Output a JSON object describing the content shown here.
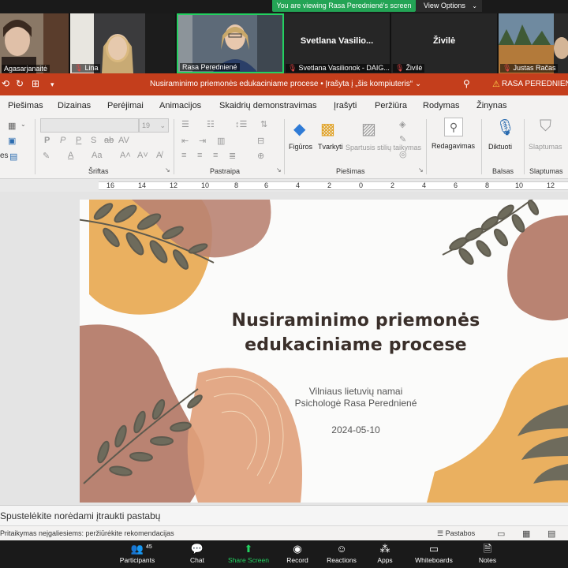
{
  "zoom": {
    "share_banner": "You are viewing Rasa Peredniené's screen",
    "view_options": "View Options",
    "participants": [
      {
        "name": "Agasarjanaitė",
        "has_video": true
      },
      {
        "name": "Lina",
        "has_video": true
      },
      {
        "name": "Rasa Peredniené",
        "has_video": true,
        "active": true
      },
      {
        "name": "Svetlana Vasilionok - DAIG...",
        "display": "Svetlana  Vasilio...",
        "muted": true
      },
      {
        "name": "Živilė",
        "display": "Živilė",
        "muted": true
      },
      {
        "name": "Justas Račas",
        "has_video": true,
        "muted": true
      }
    ],
    "toolbar": {
      "participants": "Participants",
      "participants_count": "45",
      "chat": "Chat",
      "share_screen": "Share Screen",
      "record": "Record",
      "reactions": "Reactions",
      "apps": "Apps",
      "whiteboards": "Whiteboards",
      "notes": "Notes"
    }
  },
  "ppt": {
    "doc_title": "Nusiraminimo priemonės edukaciniame procese  •  Įrašyta į „šis kompiuteris“ ⌄",
    "user": "RASA PEREDNIENĖ",
    "tabs": [
      "Piešimas",
      "Dizainas",
      "Perėjimai",
      "Animacijos",
      "Skaidrių demonstravimas",
      "Įrašyti",
      "Peržiūra",
      "Rodymas",
      "Žinynas"
    ],
    "font_size": "19",
    "groups": {
      "font": "Šriftas",
      "paragraph": "Pastraipa",
      "drawing": "Piešimas",
      "voice": "Balsas",
      "sensitivity": "Slaptumas"
    },
    "side_label": "es",
    "buttons": {
      "shapes": "Figūros",
      "arrange": "Tvarkyti",
      "quick_styles": "Spartusis stilių taikymas",
      "editing": "Redagavimas",
      "dictate": "Diktuoti",
      "sensitivity": "Slaptumas"
    },
    "ruler_numbers": [
      "16",
      "14",
      "12",
      "10",
      "8",
      "6",
      "4",
      "2",
      "0",
      "2",
      "4",
      "6",
      "8",
      "10",
      "12"
    ],
    "slide": {
      "title_line1": "Nusiraminimo priemonės",
      "title_line2": "edukaciniame procese",
      "org": "Vilniaus lietuvių namai",
      "author": "Psichologė Rasa Peredniené",
      "date": "2024-05-10"
    },
    "notes_placeholder": "Spustelėkite norėdami įtraukti pastabų",
    "accessibility": "Pritaikymas neįgaliesiems: peržiūrėkite rekomendacijas",
    "notes_button": "Pastabos"
  }
}
